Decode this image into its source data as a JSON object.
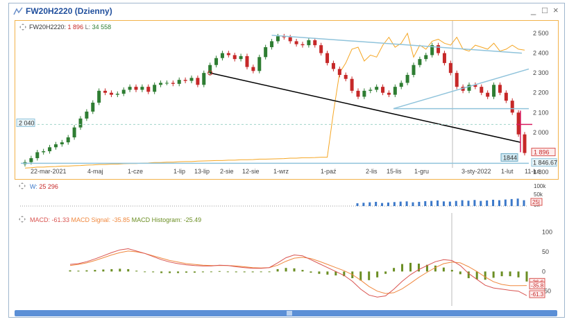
{
  "window": {
    "title": "FW20H2220 (Dzienny)",
    "controls": [
      "_",
      "□",
      "×"
    ]
  },
  "panels": {
    "price_legend": {
      "symbol": "FW20H2220:",
      "value": "1 896",
      "l_label": "L:",
      "l_value": "34 558"
    },
    "volume_legend": {
      "label": "W:",
      "value": "25 296"
    },
    "macd_legend": {
      "macd": "MACD: -61.33",
      "signal": "MACD Signal: -35.85",
      "hist": "MACD Histogram: -25.49"
    }
  },
  "colors": {
    "up": "#2e7d32",
    "down": "#c62828",
    "oi": "#f5a623",
    "trend": "#000000",
    "channel": "#8fc3db",
    "macd": "#d9534f",
    "signal": "#f0883e",
    "hist": "#6b8e23",
    "volume": "#3b78c9"
  },
  "chart_data": [
    {
      "type": "candlestick",
      "title": "FW20H2220",
      "x_ticks": [
        "22-mar-2021",
        "4-maj",
        "1-cze",
        "1-lip",
        "13-lip",
        "2-sie",
        "12-sie",
        "1-wrz",
        "1-paź",
        "2-lis",
        "15-lis",
        "1-gru",
        "3-sty-2022",
        "1-lut",
        "11-lut"
      ],
      "y_ticks": [
        "2 500",
        "2 400",
        "2 300",
        "2 200",
        "2 100",
        "2 000",
        "1 900",
        "1 800"
      ],
      "ylim": [
        1800,
        2500
      ],
      "close_series": [
        1850,
        1870,
        1900,
        1905,
        1925,
        1940,
        1950,
        1975,
        2025,
        2070,
        2105,
        2150,
        2210,
        2200,
        2190,
        2195,
        2215,
        2230,
        2215,
        2230,
        2205,
        2240,
        2250,
        2250,
        2245,
        2265,
        2260,
        2275,
        2240,
        2300,
        2340,
        2375,
        2400,
        2390,
        2370,
        2385,
        2330,
        2310,
        2380,
        2430,
        2460,
        2485,
        2480,
        2460,
        2445,
        2440,
        2465,
        2440,
        2400,
        2350,
        2320,
        2290,
        2270,
        2210,
        2180,
        2210,
        2215,
        2230,
        2200,
        2190,
        2230,
        2250,
        2290,
        2340,
        2370,
        2390,
        2440,
        2400,
        2350,
        2300,
        2230,
        2210,
        2240,
        2230,
        2200,
        2180,
        2240,
        2200,
        2160,
        2100,
        1990,
        1896
      ],
      "open_interest": [
        1820,
        1822,
        1825,
        1825,
        1827,
        1828,
        1830,
        1830,
        1832,
        1833,
        1835,
        1836,
        1838,
        1838,
        1840,
        1840,
        1842,
        1843,
        1843,
        1845,
        1846,
        1848,
        1848,
        1850,
        1850,
        1852,
        1853,
        1853,
        1855,
        1856,
        1857,
        1858,
        1858,
        1860,
        1860,
        1862,
        1862,
        1863,
        1865,
        1865,
        1866,
        1867,
        1868,
        1870,
        1870,
        1872,
        1872,
        1873,
        1875,
        1875,
        2100,
        2300,
        2350,
        2420,
        2430,
        2360,
        2390,
        2380,
        2440,
        2480,
        2430,
        2450,
        2500,
        2380,
        2440,
        2420,
        2460,
        2470,
        2450,
        2440,
        2480,
        2420,
        2410,
        2440,
        2430,
        2420,
        2450,
        2410,
        2420,
        2440,
        2420,
        2415
      ],
      "lines": [
        {
          "name": "trend",
          "color": "#000000"
        },
        {
          "name": "channel",
          "color": "#8fc3db"
        }
      ],
      "levels": {
        "dashed": "2 040",
        "support": "1844",
        "current": "1 896",
        "low": "1 846.67"
      }
    },
    {
      "type": "bar",
      "title": "W",
      "y_ticks": [
        "100k",
        "50k",
        "0k"
      ],
      "values": [
        0,
        0,
        0,
        0,
        0,
        0,
        0,
        0,
        0,
        0,
        0,
        0,
        0,
        0,
        0,
        0,
        0,
        0,
        0,
        0,
        0,
        0,
        0,
        0,
        0,
        0,
        0,
        0,
        0,
        0,
        0,
        0,
        0,
        0,
        0,
        0,
        0,
        0,
        0,
        0,
        0,
        0,
        0,
        0,
        0,
        0,
        0,
        0,
        0,
        0,
        0,
        0,
        0,
        0,
        12,
        14,
        16,
        18,
        13,
        15,
        17,
        19,
        20,
        16,
        18,
        21,
        22,
        24,
        20,
        19,
        22,
        25,
        23,
        26,
        22,
        24,
        27,
        25,
        28,
        30,
        32,
        25
      ]
    },
    {
      "type": "line",
      "title": "MACD",
      "y_ticks": [
        "100",
        "50",
        "0",
        "-50"
      ],
      "ylim": [
        -70,
        110
      ],
      "macd": [
        18,
        20,
        25,
        32,
        40,
        48,
        55,
        58,
        52,
        46,
        38,
        30,
        24,
        20,
        17,
        15,
        14,
        14,
        16,
        15,
        12,
        10,
        8,
        8,
        10,
        22,
        35,
        42,
        40,
        30,
        20,
        10,
        0,
        -10,
        -25,
        -45,
        -60,
        -65,
        -62,
        -45,
        -25,
        -8,
        5,
        15,
        25,
        30,
        28,
        15,
        -5,
        -20,
        -35,
        -42,
        -45,
        -48,
        -50,
        -61.3
      ],
      "signal": [
        15,
        18,
        22,
        28,
        35,
        42,
        48,
        52,
        50,
        46,
        40,
        34,
        28,
        24,
        20,
        18,
        16,
        15,
        15,
        15,
        14,
        12,
        10,
        9,
        10,
        16,
        26,
        34,
        36,
        33,
        26,
        18,
        10,
        2,
        -8,
        -22,
        -38,
        -50,
        -56,
        -54,
        -44,
        -30,
        -15,
        -2,
        10,
        20,
        24,
        22,
        12,
        0,
        -14,
        -26,
        -33,
        -36,
        -35.9,
        -35.8
      ],
      "hist": [
        3,
        2,
        3,
        4,
        5,
        6,
        7,
        6,
        2,
        0,
        -2,
        -4,
        -4,
        -4,
        -3,
        -3,
        -2,
        -1,
        1,
        0,
        -2,
        -2,
        -2,
        -1,
        0,
        6,
        9,
        8,
        4,
        -3,
        -6,
        -8,
        -10,
        -12,
        -17,
        -23,
        -22,
        -15,
        -6,
        9,
        19,
        22,
        20,
        17,
        15,
        10,
        4,
        -7,
        -17,
        -20,
        -21,
        -16,
        -12,
        -12,
        -15,
        -25.49
      ],
      "series_labels": [
        "-36.6",
        "-35.8",
        "-61.3"
      ]
    }
  ]
}
